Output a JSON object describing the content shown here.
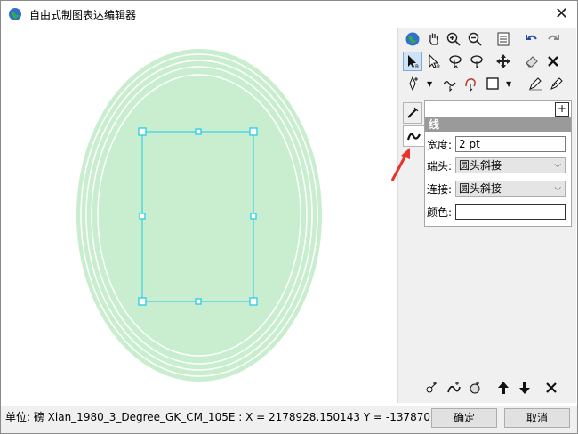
{
  "window": {
    "title": "自由式制图表达编辑器",
    "icon": "globe-icon",
    "close_glyph": "✕"
  },
  "toolbar": {
    "row1": [
      "globe-icon",
      "pan-hand-icon",
      "zoom-in-icon",
      "zoom-out-icon",
      "list-icon",
      "undo-icon",
      "redo-icon"
    ],
    "row2": [
      "select-arrow-icon",
      "select-part-icon",
      "rotate-select-icon",
      "reshape-icon",
      "move-icon",
      "eraser-icon",
      "delete-icon"
    ],
    "row3": [
      "add-vertex-icon",
      "freehand-icon",
      "curve-icon",
      "rectangle-icon",
      "pen-icon",
      "pen-alt-icon"
    ]
  },
  "props": {
    "header": "线",
    "expand": "+",
    "width_label": "宽度:",
    "width_value": "2 pt",
    "cap_label": "端头:",
    "cap_value": "圆头斜接",
    "join_label": "连接:",
    "join_value": "圆头斜接",
    "color_label": "颜色:"
  },
  "status": {
    "text": "单位: 磅   Xian_1980_3_Degree_GK_CM_105E :  X = 2178928.150143     Y = -1378707.564990"
  },
  "buttons": {
    "ok": "确定",
    "cancel": "取消"
  },
  "colors": {
    "shape_fill": "#c8eecf",
    "ring_stroke": "#ffffff",
    "selection": "#19c9e8",
    "annotation_arrow": "#e8322a",
    "header_bg": "#9a9a9a"
  }
}
